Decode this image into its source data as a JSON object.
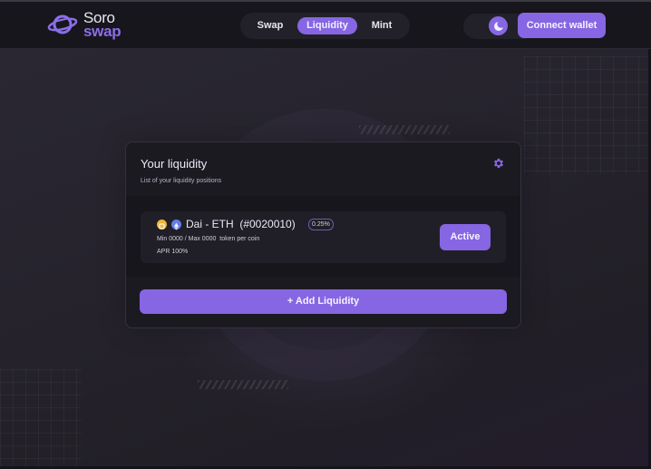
{
  "header": {
    "logo": {
      "top": "Soro",
      "bottom": "swap"
    },
    "nav": [
      {
        "label": "Swap",
        "active": false
      },
      {
        "label": "Liquidity",
        "active": true
      },
      {
        "label": "Mint",
        "active": false
      }
    ],
    "theme_toggle_icon": "moon-icon",
    "connect_wallet_label": "Connect wallet"
  },
  "liquidity_card": {
    "title": "Your liquidity",
    "subtitle": "List of your liquidity positions",
    "settings_icon": "gear-icon",
    "positions": [
      {
        "token_icons": [
          "dai-icon",
          "eth-icon"
        ],
        "pair": "Dai - ETH  (#0020010)",
        "fee": "0.25%",
        "range": "Min 0000 / Max 0000  token per coin",
        "apr": "APR 100%",
        "status_label": "Active"
      }
    ],
    "add_liquidity_label": "+ Add Liquidity"
  },
  "colors": {
    "accent": "#8666e3",
    "background": "#1f1d26",
    "header": "#17161c",
    "card": "#1b1a21",
    "dai": "#f2b43c",
    "eth": "#627ee6"
  }
}
